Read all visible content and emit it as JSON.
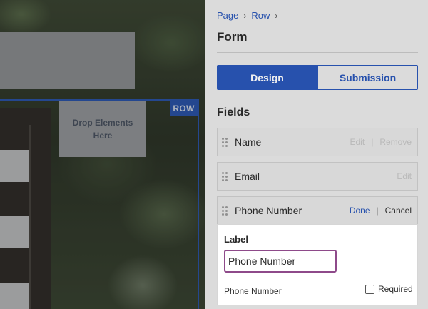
{
  "canvas": {
    "drop_placeholder": "Drop Elements Here",
    "row_badge": "ROW"
  },
  "breadcrumb": {
    "items": [
      "Page",
      "Row"
    ],
    "separator": "›"
  },
  "panel": {
    "title": "Form",
    "tabs": [
      {
        "label": "Design",
        "active": true
      },
      {
        "label": "Submission",
        "active": false
      }
    ],
    "fields_section_title": "Fields",
    "fields": [
      {
        "label": "Name",
        "actions": [
          "Edit",
          "Remove"
        ]
      },
      {
        "label": "Email",
        "actions": [
          "Edit"
        ]
      },
      {
        "label": "Phone Number",
        "actions": [
          "Done",
          "Cancel"
        ]
      }
    ],
    "editor": {
      "label_title": "Label",
      "label_value": "Phone Number",
      "preview_label": "Phone Number",
      "required_label": "Required",
      "required_checked": false
    }
  },
  "colors": {
    "accent": "#2a57b8",
    "input_focus_border": "#8e4a8a",
    "panel_bg": "#e9e9e9"
  },
  "icons": {
    "drag_handle": "drag-handle-icon",
    "breadcrumb_separator": "chevron-right-icon"
  }
}
